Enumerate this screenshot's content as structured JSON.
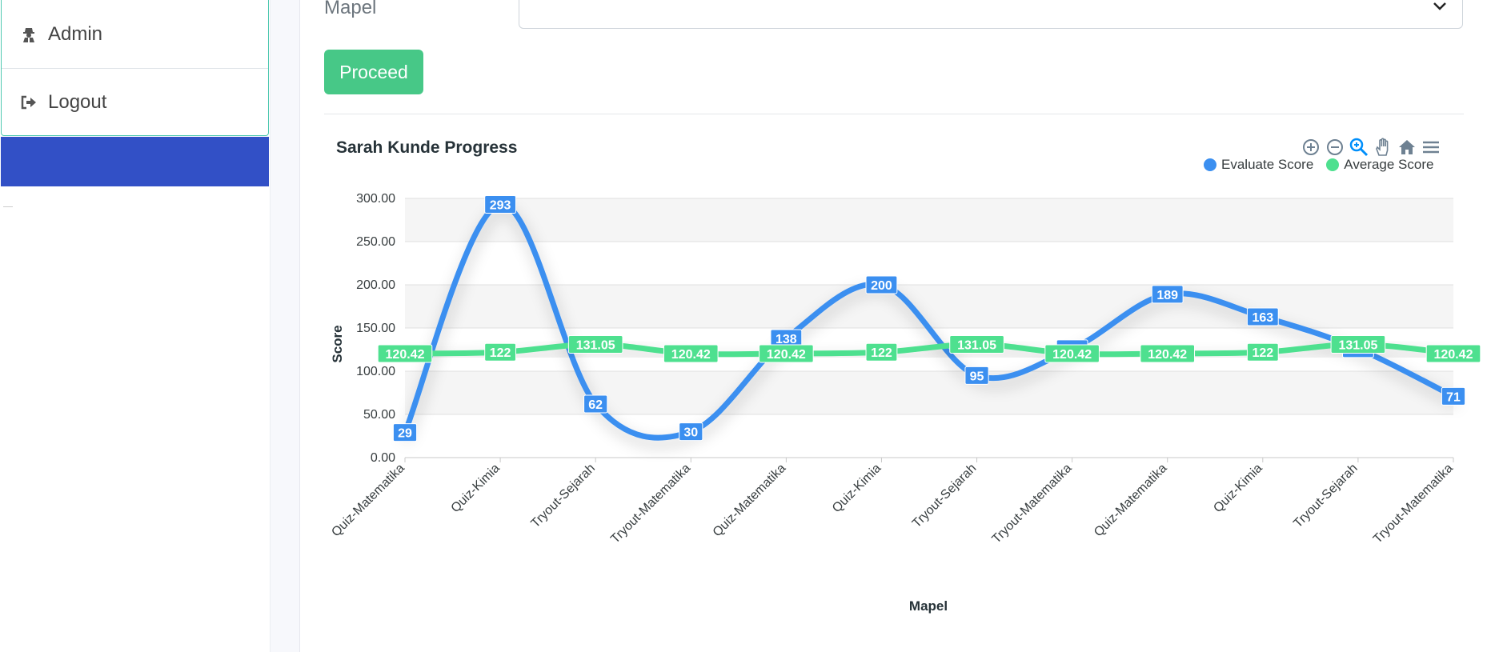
{
  "sidebar": {
    "items": [
      {
        "label": "Admin",
        "icon": "user-secret-icon"
      },
      {
        "label": "Logout",
        "icon": "sign-out-icon"
      }
    ],
    "accent_color": "#3250c6"
  },
  "form": {
    "mapel_label": "Mapel",
    "mapel_value": "",
    "proceed_label": "Proceed",
    "proceed_color": "#47c887"
  },
  "chart": {
    "title": "Sarah Kunde Progress",
    "toolbar": [
      "zoom-in-icon",
      "zoom-out-icon",
      "zoom-selection-icon",
      "pan-hand-icon",
      "reset-home-icon",
      "menu-icon"
    ],
    "legend": [
      {
        "name": "Evaluate Score",
        "color": "#3b8ff0"
      },
      {
        "name": "Average Score",
        "color": "#4ee08f"
      }
    ]
  },
  "chart_data": {
    "type": "line",
    "title": "Sarah Kunde Progress",
    "xlabel": "Mapel",
    "ylabel": "Score",
    "ylim": [
      0,
      300
    ],
    "yticks": [
      "0.00",
      "50.00",
      "100.00",
      "150.00",
      "200.00",
      "250.00",
      "300.00"
    ],
    "categories": [
      "Quiz-Matematika",
      "Quiz-Kimia",
      "Tryout-Sejarah",
      "Tryout-Matematika",
      "Quiz-Matematika",
      "Quiz-Kimia",
      "Tryout-Sejarah",
      "Tryout-Matematika",
      "Quiz-Matematika",
      "Quiz-Kimia",
      "Tryout-Sejarah",
      "Tryout-Matematika"
    ],
    "series": [
      {
        "name": "Evaluate Score",
        "color": "#3b8ff0",
        "values": [
          29,
          293,
          62,
          30,
          138,
          200,
          95,
          126,
          189,
          163,
          126,
          71
        ]
      },
      {
        "name": "Average Score",
        "color": "#4ee08f",
        "values": [
          120.42,
          122,
          131.05,
          120.42,
          120.42,
          122,
          131.05,
          120.42,
          120.42,
          122,
          131.05,
          120.42
        ]
      }
    ],
    "legend_position": "top-right",
    "grid": true
  }
}
